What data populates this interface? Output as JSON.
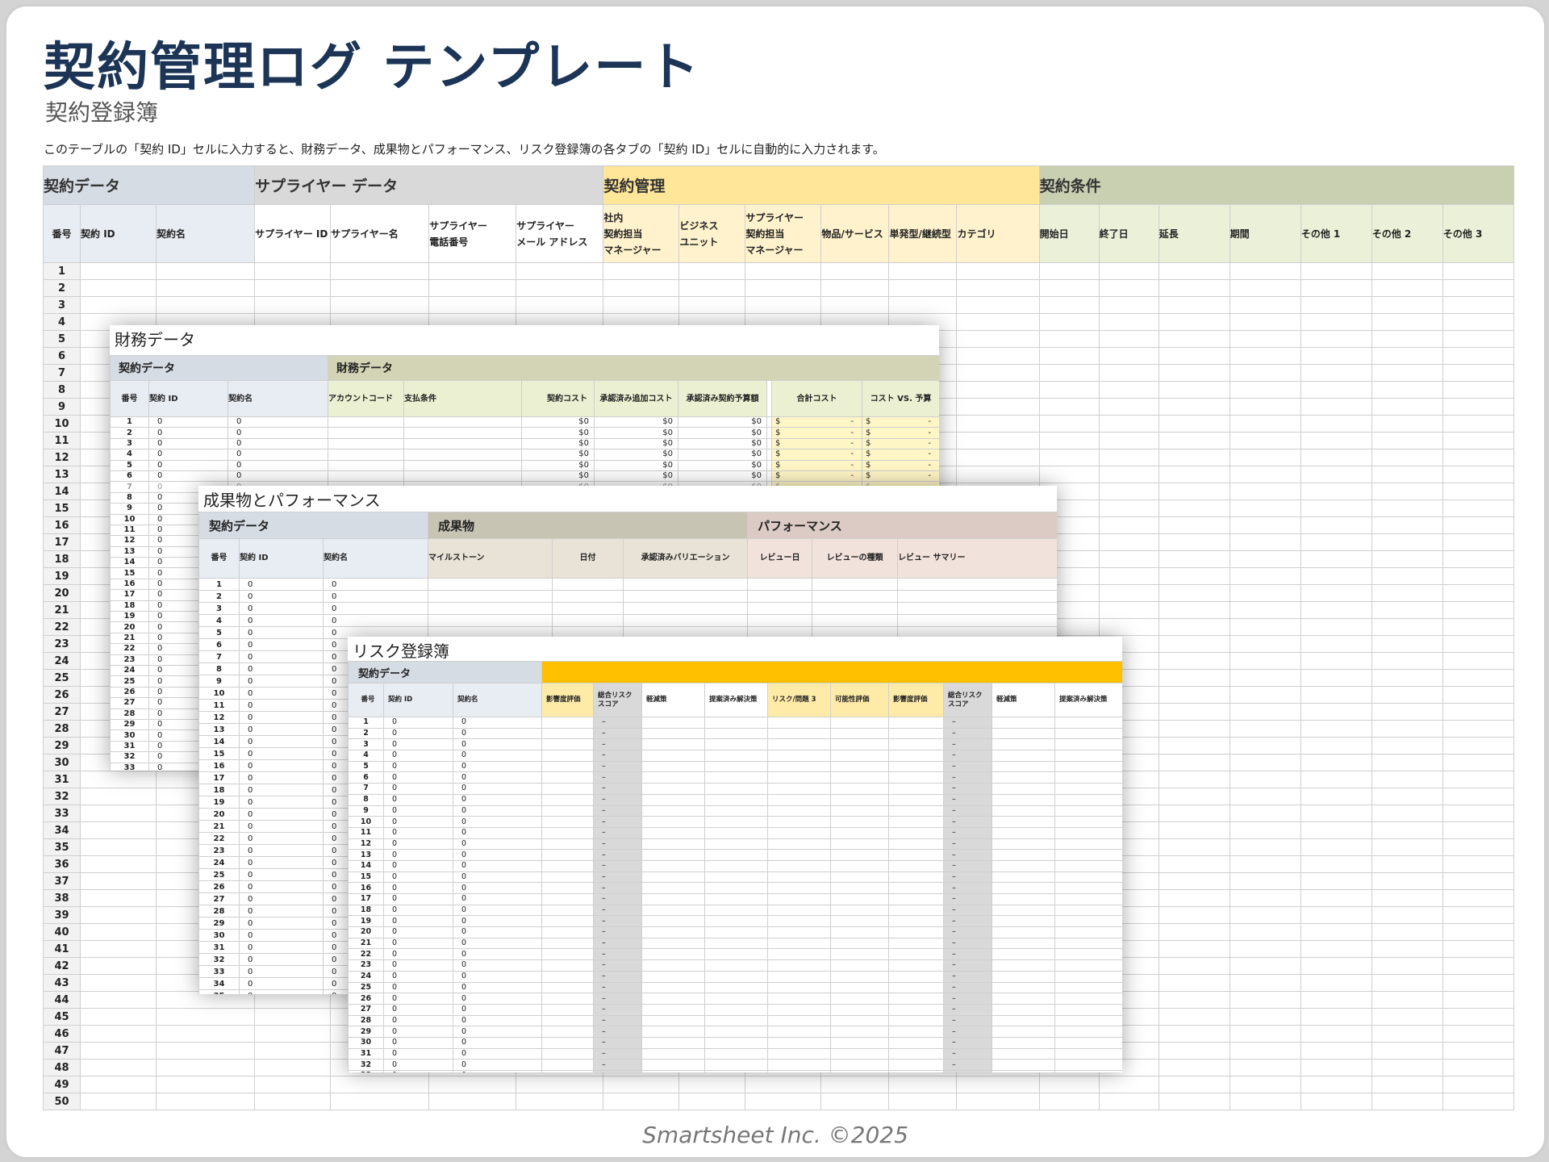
{
  "title": "契約管理ログ テンプレート",
  "subtitle": "契約登録簿",
  "note": "このテーブルの「契約 ID」セルに入力すると、財務データ、成果物とパフォーマンス、リスク登録簿の各タブの「契約 ID」セルに自動的に入力されます。",
  "footer": "Smartsheet Inc. ©2025",
  "colors": {
    "title": "#1c3557",
    "blue_group": "#d6dce4",
    "blue_header": "#e8ecf3",
    "gray_group": "#d9d9d9",
    "yellow_group": "#ffe699",
    "yellow_header": "#fff2cc",
    "green_group": "#c9cfb1",
    "green_header": "#ebf0d8",
    "fin_group": "#d2d4b5",
    "fin_header": "#ebf0d2",
    "fin_total": "#fff6c6",
    "deliv_group": "#c8c4b4",
    "deliv_header": "#e8e3d6",
    "perf_group": "#dccbc4",
    "perf_header": "#f2e2dc",
    "risk_orange": "#ffc000",
    "risk_yellow": "#ffeba8"
  },
  "main": {
    "groups": [
      {
        "label": "契約データ",
        "span": 3,
        "color": "#d6dce4"
      },
      {
        "label": "サプライヤー データ",
        "span": 4,
        "color": "#d9d9d9"
      },
      {
        "label": "契約管理",
        "span": 6,
        "color": "#ffe699"
      },
      {
        "label": "契約条件",
        "span": 7,
        "color": "#c9cfb1"
      }
    ],
    "columns": [
      {
        "label": "番号",
        "w": 46,
        "bg": "#e8ecf3",
        "align": "c"
      },
      {
        "label": "契約 ID",
        "w": 94,
        "bg": "#e8ecf3"
      },
      {
        "label": "契約名",
        "w": 122,
        "bg": "#e8ecf3"
      },
      {
        "label": "サプライヤー ID",
        "w": 94,
        "bg": "#ffffff"
      },
      {
        "label": "サプライヤー名",
        "w": 122,
        "bg": "#ffffff"
      },
      {
        "label": "サプライヤー\n電話番号",
        "w": 108,
        "bg": "#ffffff"
      },
      {
        "label": "サプライヤー\nメール アドレス",
        "w": 108,
        "bg": "#ffffff"
      },
      {
        "label": "社内\n契約担当\nマネージャー",
        "w": 94,
        "bg": "#fff2cc"
      },
      {
        "label": "ビジネス\nユニット",
        "w": 82,
        "bg": "#fff2cc"
      },
      {
        "label": "サプライヤー\n契約担当\nマネージャー",
        "w": 94,
        "bg": "#fff2cc"
      },
      {
        "label": "物品/サービス",
        "w": 84,
        "bg": "#fff2cc"
      },
      {
        "label": "単発型/継続型",
        "w": 84,
        "bg": "#fff2cc"
      },
      {
        "label": "カテゴリ",
        "w": 102,
        "bg": "#fff2cc"
      },
      {
        "label": "開始日",
        "w": 74,
        "bg": "#ebf0d8"
      },
      {
        "label": "終了日",
        "w": 74,
        "bg": "#ebf0d8"
      },
      {
        "label": "延長",
        "w": 88,
        "bg": "#ebf0d8"
      },
      {
        "label": "期間",
        "w": 88,
        "bg": "#ebf0d8"
      },
      {
        "label": "その他 1",
        "w": 88,
        "bg": "#ebf0d8"
      },
      {
        "label": "その他 2",
        "w": 88,
        "bg": "#ebf0d8"
      },
      {
        "label": "その他 3",
        "w": 88,
        "bg": "#ebf0d8"
      }
    ],
    "row_count": 50
  },
  "financial": {
    "title": "財務データ",
    "groups": [
      {
        "label": "契約データ",
        "span": 3,
        "color": "#d6dce4"
      },
      {
        "label": "財務データ",
        "span": 8,
        "color": "#d2d4b5"
      }
    ],
    "columns": [
      {
        "label": "番号",
        "w": 48,
        "bg": "#e8ecf3",
        "align": "c"
      },
      {
        "label": "契約 ID",
        "w": 98,
        "bg": "#e8ecf3"
      },
      {
        "label": "契約名",
        "w": 124,
        "bg": "#e8ecf3"
      },
      {
        "label": "アカウントコード",
        "w": 94,
        "bg": "#ebf0d2"
      },
      {
        "label": "支払条件",
        "w": 146,
        "bg": "#ebf0d2"
      },
      {
        "label": "契約コスト",
        "w": 90,
        "bg": "#ebf0d2",
        "align": "r"
      },
      {
        "label": "承認済み追加コスト",
        "w": 104,
        "bg": "#ebf0d2",
        "align": "c"
      },
      {
        "label": "承認済み契約予算額",
        "w": 110,
        "bg": "#ebf0d2",
        "align": "c"
      },
      {
        "label": "",
        "w": 6,
        "bg": "#ffffff"
      },
      {
        "label": "合計コスト",
        "w": 112,
        "bg": "#ebf0d2",
        "align": "c"
      },
      {
        "label": "コスト VS. 予算",
        "w": 96,
        "bg": "#ebf0d2",
        "align": "c"
      }
    ],
    "row_count": 35,
    "money_rows": 7,
    "zero_money": "$0",
    "dollar": "$",
    "dash": "-",
    "zero": "0"
  },
  "performance": {
    "title": "成果物とパフォーマンス",
    "groups": [
      {
        "label": "契約データ",
        "span": 3,
        "color": "#d6dce4"
      },
      {
        "label": "成果物",
        "span": 3,
        "color": "#c8c4b4"
      },
      {
        "label": "パフォーマンス",
        "span": 3,
        "color": "#dccbc4"
      }
    ],
    "columns": [
      {
        "label": "番号",
        "w": 50,
        "bg": "#e8ecf3",
        "align": "c"
      },
      {
        "label": "契約 ID",
        "w": 104,
        "bg": "#e8ecf3"
      },
      {
        "label": "契約名",
        "w": 130,
        "bg": "#e8ecf3"
      },
      {
        "label": "マイルストーン",
        "w": 154,
        "bg": "#e8e3d6"
      },
      {
        "label": "日付",
        "w": 88,
        "bg": "#e8e3d6",
        "align": "c"
      },
      {
        "label": "承認済みバリエーション",
        "w": 154,
        "bg": "#e8e3d6",
        "align": "c"
      },
      {
        "label": "レビュー日",
        "w": 80,
        "bg": "#f2e2dc",
        "align": "c"
      },
      {
        "label": "レビューの種類",
        "w": 106,
        "bg": "#f2e2dc",
        "align": "c"
      },
      {
        "label": "レビュー サマリー",
        "w": 198,
        "bg": "#f2e2dc"
      }
    ],
    "row_count": 35,
    "zero": "0"
  },
  "risk": {
    "title": "リスク登録簿",
    "groups": [
      {
        "label": "契約データ",
        "span": 3,
        "color": "#d6dce4"
      },
      {
        "label": "",
        "span": 12,
        "color": "#ffc000"
      }
    ],
    "columns": [
      {
        "label": "番号",
        "w": 44,
        "bg": "#e8ecf3",
        "align": "c"
      },
      {
        "label": "契約 ID",
        "w": 86,
        "bg": "#e8ecf3"
      },
      {
        "label": "契約名",
        "w": 110,
        "bg": "#e8ecf3"
      },
      {
        "label": "影響度評価",
        "w": 64,
        "bg": "#ffeba8"
      },
      {
        "label": "総合リスク\nスコア",
        "w": 60,
        "bg": "#d9d9d9",
        "gray": true
      },
      {
        "label": "軽減策",
        "w": 78,
        "bg": "#ffffff"
      },
      {
        "label": "提案済み解決策",
        "w": 78,
        "bg": "#ffffff"
      },
      {
        "label": "リスク/問題 3",
        "w": 78,
        "bg": "#ffeba8"
      },
      {
        "label": "可能性評価",
        "w": 72,
        "bg": "#ffeba8"
      },
      {
        "label": "影響度評価",
        "w": 68,
        "bg": "#ffeba8"
      },
      {
        "label": "総合リスク\nスコア",
        "w": 60,
        "bg": "#d9d9d9",
        "gray": true
      },
      {
        "label": "軽減策",
        "w": 78,
        "bg": "#ffffff"
      },
      {
        "label": "提案済み解決策",
        "w": 84,
        "bg": "#ffffff"
      }
    ],
    "row_count": 35,
    "zero": "0",
    "dash": "–"
  }
}
